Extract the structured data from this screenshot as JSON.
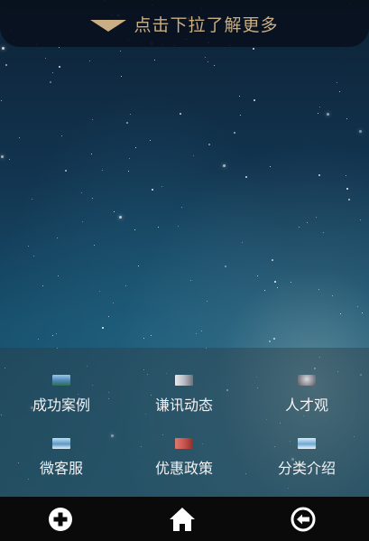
{
  "header": {
    "pulldown_text": "点击下拉了解更多"
  },
  "menu": {
    "items": [
      {
        "label": "成功案例",
        "icon": "landscape-thumbnail-icon",
        "color": "#4a86b5"
      },
      {
        "label": "谦讯动态",
        "icon": "news-thumbnail-icon",
        "color": "#b9bcc4"
      },
      {
        "label": "人才观",
        "icon": "people-thumbnail-icon",
        "color": "#8a8c94"
      },
      {
        "label": "微客服",
        "icon": "sky-thumbnail-icon",
        "color": "#5a9ac8"
      },
      {
        "label": "优惠政策",
        "icon": "promo-thumbnail-icon",
        "color": "#c8554e"
      },
      {
        "label": "分类介绍",
        "icon": "mountain-thumbnail-icon",
        "color": "#6ca8d6"
      }
    ]
  },
  "tabbar": {
    "items": [
      {
        "icon": "plus-circle-icon"
      },
      {
        "icon": "home-icon"
      },
      {
        "icon": "back-circle-icon"
      }
    ]
  }
}
